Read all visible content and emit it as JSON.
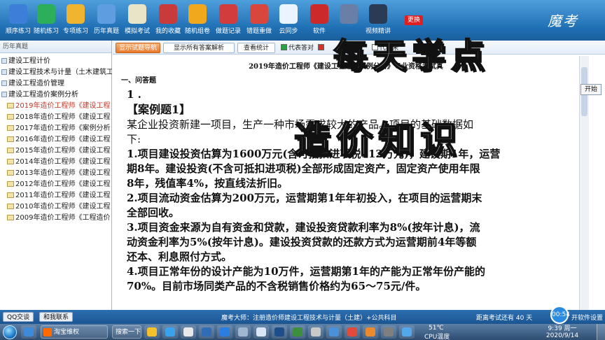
{
  "toolbar": {
    "items": [
      {
        "label": "顺序练习",
        "icon": "sequence-practice-icon",
        "color": "#3d7fd8"
      },
      {
        "label": "随机练习",
        "icon": "random-practice-icon",
        "color": "#2cae5a"
      },
      {
        "label": "专项练习",
        "icon": "special-practice-icon",
        "color": "#f0b430"
      },
      {
        "label": "历年真题",
        "icon": "past-exams-icon",
        "color": "#5d9de0"
      },
      {
        "label": "模拟考试",
        "icon": "mock-exam-icon",
        "color": "#e9e3c8"
      },
      {
        "label": "我的收藏",
        "icon": "favorites-icon",
        "color": "#c93b3b"
      },
      {
        "label": "随机组卷",
        "icon": "random-paper-icon",
        "color": "#f2a81d"
      },
      {
        "label": "做题记录",
        "icon": "record-icon",
        "color": "#d33c3c"
      },
      {
        "label": "错题重做",
        "icon": "redo-wrong-icon",
        "color": "#d8463e"
      },
      {
        "label": "云同步",
        "icon": "cloud-sync-icon",
        "color": "#eaf4ff"
      },
      {
        "label": "软件",
        "icon": "software-icon",
        "color": "#cc2a2a"
      },
      {
        "label": "",
        "icon": "user-icon",
        "color": "#6a7fa8"
      },
      {
        "label": "视频精讲",
        "icon": "video-icon",
        "color": "#2b3a55"
      }
    ],
    "update_label": "更换",
    "brand": "魔考"
  },
  "left_panel": {
    "header": "历年真题",
    "tree": [
      {
        "label": "建设工程计价",
        "level": "root"
      },
      {
        "label": "建设工程技术与计量（土木建筑工",
        "level": "root"
      },
      {
        "label": "建设工程造价管理",
        "level": "root"
      },
      {
        "label": "建设工程造价案例分析",
        "level": "root"
      },
      {
        "label": "2019年造价工程师《建设工程",
        "level": "child",
        "selected": true
      },
      {
        "label": "2018年造价工程师《建设工程",
        "level": "child"
      },
      {
        "label": "2017年造价工程师《案例分析",
        "level": "child"
      },
      {
        "label": "2016年造价工程师《建设工程",
        "level": "child"
      },
      {
        "label": "2015年造价工程师《建设工程",
        "level": "child"
      },
      {
        "label": "2014年造价工程师《建设工程",
        "level": "child"
      },
      {
        "label": "2013年造价工程师《建设工程",
        "level": "child"
      },
      {
        "label": "2012年造价工程师《建设工程",
        "level": "child"
      },
      {
        "label": "2011年造价工程师《建设工程",
        "level": "child"
      },
      {
        "label": "2010年造价工程师《建设工程",
        "level": "child"
      },
      {
        "label": "2009年造价工程师《工程造价",
        "level": "child"
      }
    ]
  },
  "main": {
    "tabs": {
      "guide": "显示试题导航",
      "show_all": "显示所有答案解析",
      "stats": "查看统计"
    },
    "legend": {
      "correct": "代表答对",
      "correct_color": "#2ea043",
      "wrong_color": "#d93025",
      "ellipsis": "代表未"
    },
    "doc_title": "2019年造价工程师《建设工程造价案例分析》专业资格考试真",
    "section": "一、问答题",
    "start_button": "开始",
    "question": {
      "number": "1 .",
      "case": "【案例题1】",
      "lines": [
        {
          "text": "某企业投资新建一项目，生产一种市场需求较大的产品。项目的基础数据如",
          "bold": false
        },
        {
          "text": "下:",
          "bold": false
        },
        {
          "text": "1.项目建设投资估算为1600万元(含可抵扣进项税112万元)，建设期1年，运营",
          "bold": true
        },
        {
          "text": "期8年。建设投资(不含可抵扣进项税)全部形成固定资产，固定资产使用年限",
          "bold": true
        },
        {
          "text": "8年，残值率4%，按直线法折旧。",
          "bold": true
        },
        {
          "text": "2.项目流动资金估算为200万元，运营期第1年年初投入，在项目的运营期末",
          "bold": true
        },
        {
          "text": "全部回收。",
          "bold": true
        },
        {
          "text": "3.项目资金来源为自有资金和贷款，建设投资贷款利率为8%(按年计息)，流",
          "bold": true
        },
        {
          "text": "动资金利率为5%(按年计息)。建设投资贷款的还款方式为运营期前4年等额",
          "bold": true
        },
        {
          "text": "还本、利息照付方式。",
          "bold": true
        },
        {
          "text": "4.项目正常年份的设计产能为10万件，运营期第1年的产能为正常年份产能的",
          "bold": true
        },
        {
          "text": "70%。目前市场同类产品的不含税销售价格约为65～75元/件。",
          "bold": true
        }
      ]
    }
  },
  "overlay": {
    "line1": "每天学点",
    "line2": "造价知识"
  },
  "statusbar": {
    "qq_tab": "QQ交谈",
    "contact_tab": "和我联系",
    "center_text": "魔考大师：注册造价师建设工程技术与计量（土建）+公共科目",
    "exam_countdown": "距离考试还有 40 天",
    "timer": "00:54",
    "settings": "开软件设置"
  },
  "taskbar": {
    "window_btn": "淘宝维权",
    "search_btn": "搜索一下",
    "temperature": "51℃",
    "cpu_label": "CPU温度",
    "time": "9:39 周一",
    "date": "2020/9/14"
  }
}
